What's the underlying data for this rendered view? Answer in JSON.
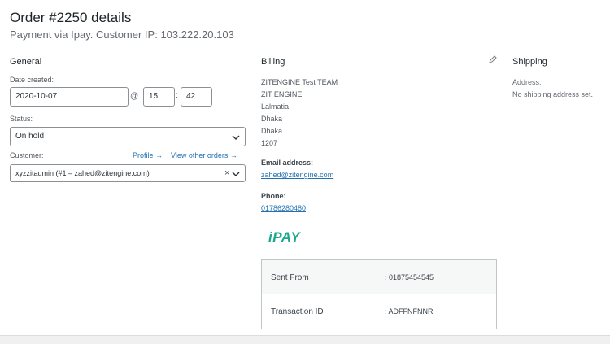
{
  "header": {
    "title": "Order #2250 details",
    "subtitle": "Payment via Ipay. Customer IP: 103.222.20.103"
  },
  "general": {
    "heading": "General",
    "date_label": "Date created:",
    "date_value": "2020-10-07",
    "at_sign": "@",
    "hour": "15",
    "colon": ":",
    "minute": "42",
    "status_label": "Status:",
    "status_value": "On hold",
    "customer_label": "Customer:",
    "profile_link": "Profile →",
    "other_orders_link": "View other orders →",
    "customer_value": "xyzzitadmin (#1 – zahed@zitengine.com)",
    "clear_symbol": "×"
  },
  "billing": {
    "heading": "Billing",
    "address_lines": [
      "ZITENGINE Test TEAM",
      "ZIT ENGINE",
      "Lalmatia",
      "Dhaka",
      "Dhaka",
      "1207"
    ],
    "email_label": "Email address:",
    "email_value": "zahed@zitengine.com",
    "phone_label": "Phone:",
    "phone_value": "01786280480",
    "payment_logo": "iPAY",
    "payment_table": [
      {
        "label": "Sent From",
        "value": ": 01875454545"
      },
      {
        "label": "Transaction ID",
        "value": ": ADFFNFNNR"
      }
    ]
  },
  "shipping": {
    "heading": "Shipping",
    "address_label": "Address:",
    "address_value": "No shipping address set."
  },
  "colors": {
    "link": "#2271b1",
    "logo": "#1aa88e",
    "border": "#8c8f94",
    "table_border": "#c3c4c7"
  },
  "icons": {
    "edit": "pencil-icon",
    "dropdown": "chevron-down-icon",
    "clear": "close-icon"
  }
}
